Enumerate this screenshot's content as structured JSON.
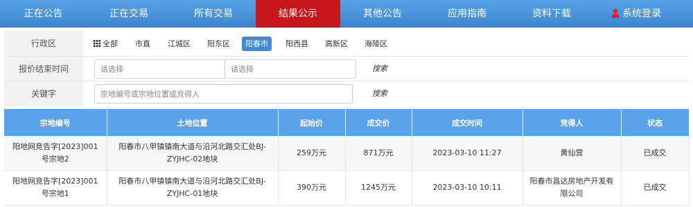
{
  "nav": {
    "items": [
      {
        "label": "正在公告"
      },
      {
        "label": "正在交易"
      },
      {
        "label": "所有交易"
      },
      {
        "label": "结果公示"
      },
      {
        "label": "其他公告"
      },
      {
        "label": "应用指南"
      },
      {
        "label": "资料下载"
      },
      {
        "label": "系统登录"
      }
    ],
    "active_index": 3,
    "login_icon": "user-icon"
  },
  "filters": {
    "district_label": "行政区",
    "district_options": [
      "全部",
      "市直",
      "江城区",
      "阳东区",
      "阳春市",
      "阳西县",
      "高新区",
      "海陵区"
    ],
    "district_selected": "阳春市",
    "all_icon": "grid-icon",
    "end_time_label": "报价结束时间",
    "start_placeholder": "请选择",
    "end_placeholder": "请选择",
    "search_label": "搜索",
    "keyword_label": "关键字",
    "keyword_placeholder": "宗地编号或宗地位置或竞得人",
    "keyword_search_label": "搜索"
  },
  "table": {
    "headers": [
      "宗地编号",
      "土地位置",
      "起始价",
      "成交价",
      "成交时间",
      "竞得人",
      "状态"
    ],
    "rows": [
      {
        "id": "阳地网竞告字[2023]001号宗地2",
        "location": "阳春市八甲镇镇南大道与沿河北路交汇处BJ-ZYJHC-02地块",
        "start_price": "259万元",
        "deal_price": "871万元",
        "deal_time": "2023-03-10 11:27",
        "winner": "黄仙营",
        "status": "已成交"
      },
      {
        "id": "阳地网竞告字[2023]001号宗地1",
        "location": "阳春市八甲镇镇南大道与沿河北路交汇处BJ-ZYJHC-01地块",
        "start_price": "390万元",
        "deal_price": "1245万元",
        "deal_time": "2023-03-10 10:11",
        "winner": "阳春市昌达房地产开发有限公司",
        "status": "已成交"
      }
    ]
  },
  "colors": {
    "nav_blue": "#4a95dc",
    "nav_active": "#c8161d",
    "table_header": "#5aa3ea",
    "status_done": "#d01f24",
    "selected_option": "#3f8bd8"
  }
}
